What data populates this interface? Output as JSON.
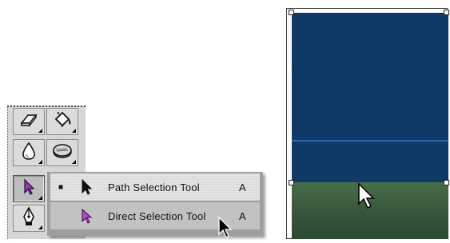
{
  "tools_palette": {
    "tools": [
      {
        "name": "eraser-tool",
        "icon": "eraser-icon",
        "has_flyout": true,
        "selected": false
      },
      {
        "name": "paint-bucket-tool",
        "icon": "paint-bucket-icon",
        "has_flyout": true,
        "selected": false
      },
      {
        "name": "blur-tool",
        "icon": "blur-drop-icon",
        "has_flyout": true,
        "selected": false
      },
      {
        "name": "dodge-tool",
        "icon": "dodge-icon",
        "has_flyout": true,
        "selected": false
      },
      {
        "name": "selection-tool",
        "icon": "direct-selection-arrow-icon",
        "has_flyout": true,
        "selected": true
      },
      {
        "name": "pen-tool",
        "icon": "pen-icon",
        "has_flyout": true,
        "selected": false
      }
    ]
  },
  "flyout_menu": {
    "items": [
      {
        "label": "Path Selection Tool",
        "shortcut": "A",
        "checked": true,
        "icon": "black-arrow-icon",
        "highlighted": false
      },
      {
        "label": "Direct Selection Tool",
        "shortcut": "A",
        "checked": false,
        "icon": "purple-arrow-icon",
        "highlighted": true
      }
    ]
  },
  "canvas": {
    "shapes": [
      {
        "name": "blue-rectangle",
        "color": "#0f3a67"
      },
      {
        "name": "green-rectangle",
        "color": "#3a5c3e"
      }
    ],
    "guide_line_color": "#2a69b0"
  },
  "colors": {
    "palette_bg": "#d6d6d6",
    "menu_highlight": "#c2c2c2",
    "selection_accent": "#9b35b8"
  }
}
